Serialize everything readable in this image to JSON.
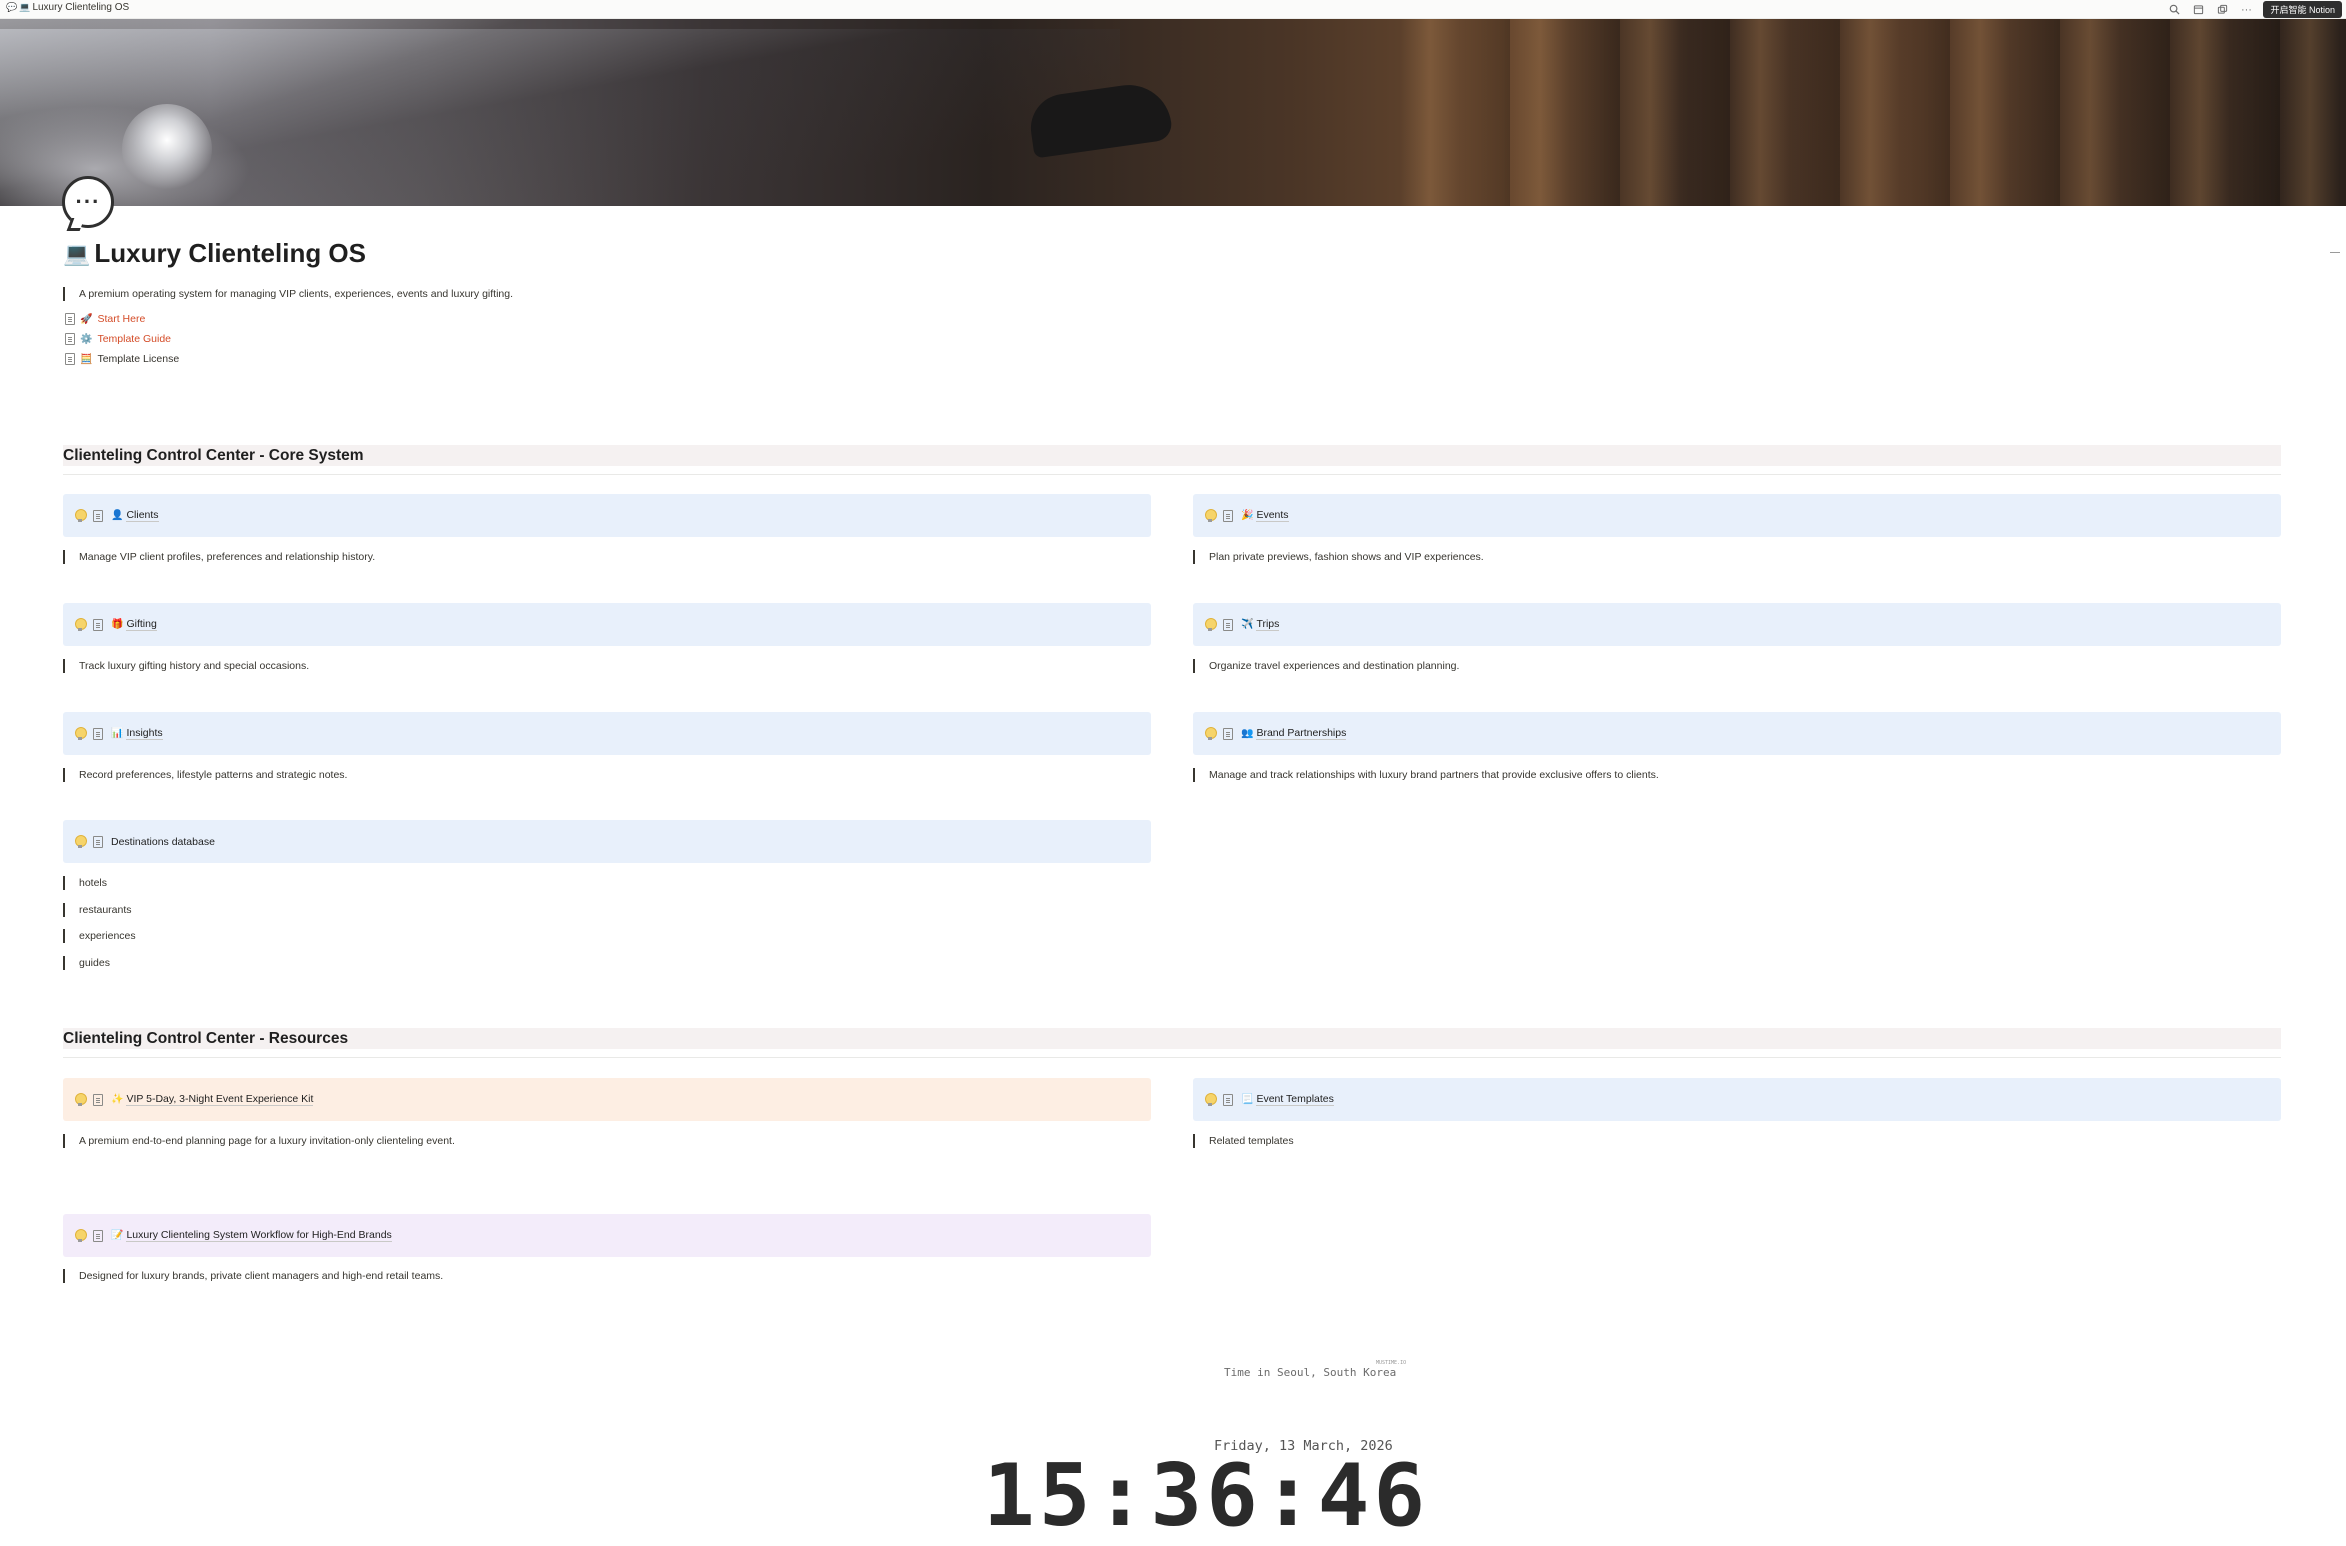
{
  "window": {
    "tab_title": "Luxury Clienteling OS",
    "notion_button": "开启智能 Notion"
  },
  "page": {
    "icon": "speech-bubble-icon",
    "title": "Luxury Clienteling OS",
    "title_emoji": "💻",
    "description": "A premium operating system for managing VIP clients, experiences, events and luxury gifting.",
    "links": [
      {
        "emoji": "🚀",
        "label": "Start Here",
        "color": "#d44c28"
      },
      {
        "emoji": "⚙️",
        "label": "Template Guide",
        "color": "#d44c28"
      },
      {
        "emoji": "🧮",
        "label": "Template License",
        "color": "#37352f"
      }
    ]
  },
  "core_section": {
    "heading": "Clienteling Control Center - Core System",
    "cards": [
      {
        "emoji": "👤",
        "label": "Clients",
        "desc": "Manage VIP client profiles, preferences and relationship history."
      },
      {
        "emoji": "🎉",
        "label": "Events",
        "desc": "Plan private previews, fashion shows and VIP experiences."
      },
      {
        "emoji": "🎁",
        "label": "Gifting",
        "desc": "Track luxury gifting history and special occasions."
      },
      {
        "emoji": "✈️",
        "label": "Trips",
        "desc": "Organize travel experiences and destination planning."
      },
      {
        "emoji": "📊",
        "label": "Insights",
        "desc": "Record preferences, lifestyle patterns and strategic notes."
      },
      {
        "emoji": "👥",
        "label": "Brand Partnerships",
        "desc": "Manage and track relationships with luxury brand partners that provide exclusive offers to clients."
      },
      {
        "emoji": "",
        "label": "Destinations database",
        "desc": ""
      }
    ],
    "destination_items": [
      "hotels",
      "restaurants",
      "experiences",
      "guides"
    ]
  },
  "resources_section": {
    "heading": "Clienteling Control Center - Resources",
    "cards": [
      {
        "emoji": "✨",
        "label": "VIP 5-Day, 3-Night Event Experience Kit",
        "desc": "A premium end-to-end planning page for a luxury invitation-only clienteling event.",
        "color": "#fdeee3"
      },
      {
        "emoji": "📃",
        "label": "Event Templates",
        "desc": "Related templates",
        "color": "#e8f0fb"
      },
      {
        "emoji": "📝",
        "label": "Luxury Clienteling System Workflow for High-End Brands",
        "desc": "Designed for luxury brands, private client managers and high-end retail teams.",
        "color": "#f3ecfa"
      }
    ]
  },
  "clock": {
    "caption": "Time in Seoul, South Korea",
    "tiny_label": "MUSTIME.IO",
    "date": "Friday, 13 March, 2026",
    "time": "15:36:46"
  }
}
